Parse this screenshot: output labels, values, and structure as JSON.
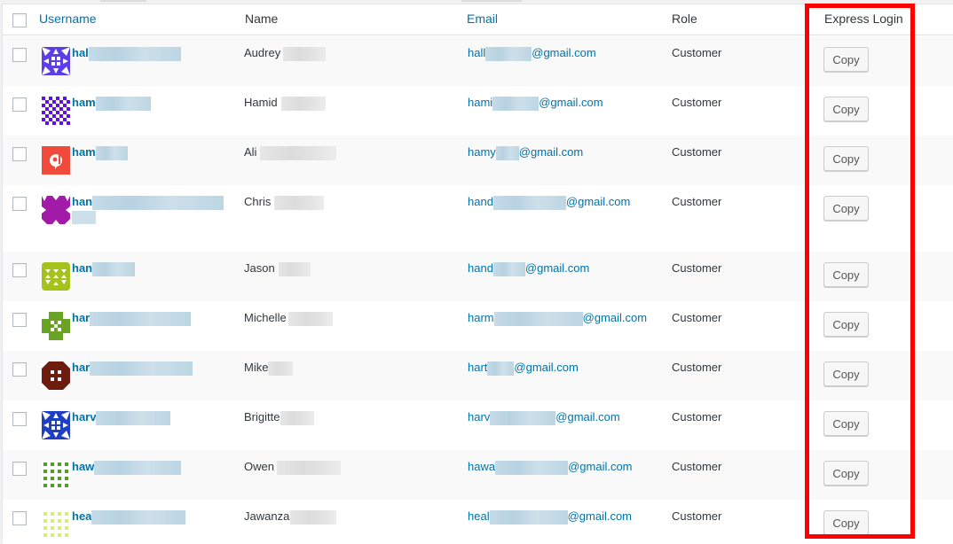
{
  "header": {
    "username": "Username",
    "name": "Name",
    "email": "Email",
    "role": "Role",
    "express_login": "Express Login"
  },
  "highlight_color": "#ff0000",
  "link_color": "#0073aa",
  "rows": [
    {
      "username": "hal",
      "name": "Audrey",
      "email_prefix": "hall",
      "email_domain": "@gmail.com",
      "role": "Customer",
      "action": "Copy",
      "avatar_color": "#5b3ee8",
      "avatar_icon": "identicon-star"
    },
    {
      "username": "ham",
      "name": "Hamid",
      "email_prefix": "hami",
      "email_domain": "@gmail.com",
      "role": "Customer",
      "action": "Copy",
      "avatar_color": "#5a12e6",
      "avatar_icon": "identicon-checker"
    },
    {
      "username": "ham",
      "name": "Ali",
      "email_prefix": "hamy",
      "email_domain": "@gmail.com",
      "role": "Customer",
      "action": "Copy",
      "avatar_color": "#f04a3c",
      "avatar_icon": "custom-avatar"
    },
    {
      "username": "han",
      "name": "Chris",
      "email_prefix": "hand",
      "email_domain": "@gmail.com",
      "role": "Customer",
      "action": "Copy",
      "avatar_color": "#a21aa8",
      "avatar_icon": "identicon-cross"
    },
    {
      "username": "han",
      "name": "Jason",
      "email_prefix": "hand",
      "email_domain": "@gmail.com",
      "role": "Customer",
      "action": "Copy",
      "avatar_color": "#a4c21c",
      "avatar_icon": "identicon-triangles"
    },
    {
      "username": "har",
      "name": "Michelle",
      "email_prefix": "harm",
      "email_domain": "@gmail.com",
      "role": "Customer",
      "action": "Copy",
      "avatar_color": "#6aa323",
      "avatar_icon": "identicon-grid"
    },
    {
      "username": "har",
      "name": "Mike",
      "email_prefix": "hart",
      "email_domain": "@gmail.com",
      "role": "Customer",
      "action": "Copy",
      "avatar_color": "#6e1c10",
      "avatar_icon": "identicon-window"
    },
    {
      "username": "harv",
      "name": "Brigitte",
      "email_prefix": "harv",
      "email_domain": "@gmail.com",
      "role": "Customer",
      "action": "Copy",
      "avatar_color": "#1f3fc2",
      "avatar_icon": "identicon-star"
    },
    {
      "username": "haw",
      "name": "Owen",
      "email_prefix": "hawa",
      "email_domain": "@gmail.com",
      "role": "Customer",
      "action": "Copy",
      "avatar_color": "#5a9a28",
      "avatar_icon": "identicon-dots"
    },
    {
      "username": "hea",
      "name": "Jawanza",
      "email_prefix": "heal",
      "email_domain": "@gmail.com",
      "role": "Customer",
      "action": "Copy",
      "avatar_color": "#d9ea7a",
      "avatar_icon": "identicon-dots"
    }
  ]
}
